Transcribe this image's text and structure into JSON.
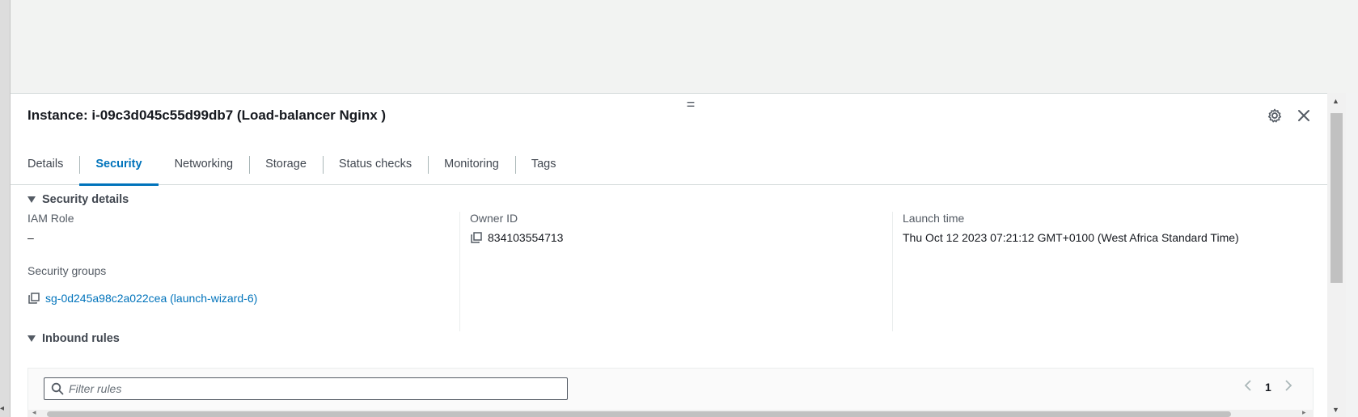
{
  "panel": {
    "title": "Instance: i-09c3d045c55d99db7 (Load-balancer Nginx )",
    "drag_handle": "=",
    "settings_icon": "gear-icon",
    "close_icon": "close-icon"
  },
  "tabs": [
    {
      "label": "Details"
    },
    {
      "label": "Security",
      "active": true
    },
    {
      "label": "Networking"
    },
    {
      "label": "Storage"
    },
    {
      "label": "Status checks"
    },
    {
      "label": "Monitoring"
    },
    {
      "label": "Tags"
    }
  ],
  "security_details": {
    "header": "Security details",
    "iam_role": {
      "label": "IAM Role",
      "value": "–"
    },
    "owner_id": {
      "label": "Owner ID",
      "value": "834103554713"
    },
    "launch_time": {
      "label": "Launch time",
      "value": "Thu Oct 12 2023 07:21:12 GMT+0100 (West Africa Standard Time)"
    },
    "security_groups": {
      "label": "Security groups",
      "value": "sg-0d245a98c2a022cea (launch-wizard-6)"
    }
  },
  "inbound_rules": {
    "header": "Inbound rules",
    "filter_placeholder": "Filter rules",
    "filter_value": "",
    "page": "1"
  },
  "colors": {
    "accent": "#0073bb",
    "text": "#16191f",
    "muted": "#545b64",
    "background": "#f2f3f3"
  }
}
